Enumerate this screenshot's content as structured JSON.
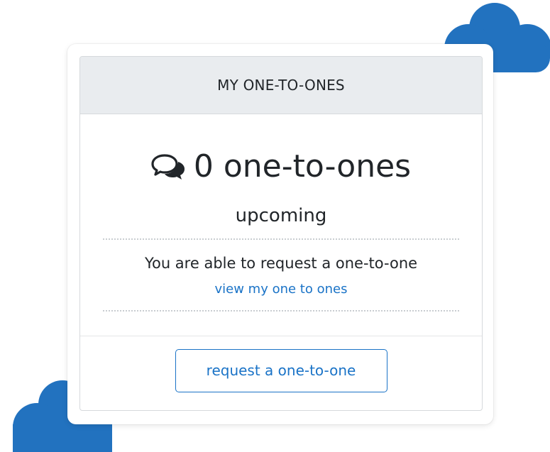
{
  "colors": {
    "accent": "#1a73c7",
    "cloud": "#2272bf",
    "header_bg": "#e9ecef",
    "text": "#212529"
  },
  "panel": {
    "header_title": "MY ONE-TO-ONES",
    "icon": "chat-bubbles-icon",
    "count_text": "0 one-to-ones",
    "upcoming_label": "upcoming",
    "info_text": "You are able to request a one-to-one",
    "view_link_label": "view my one to ones"
  },
  "footer": {
    "request_button_label": "request a one-to-one"
  }
}
